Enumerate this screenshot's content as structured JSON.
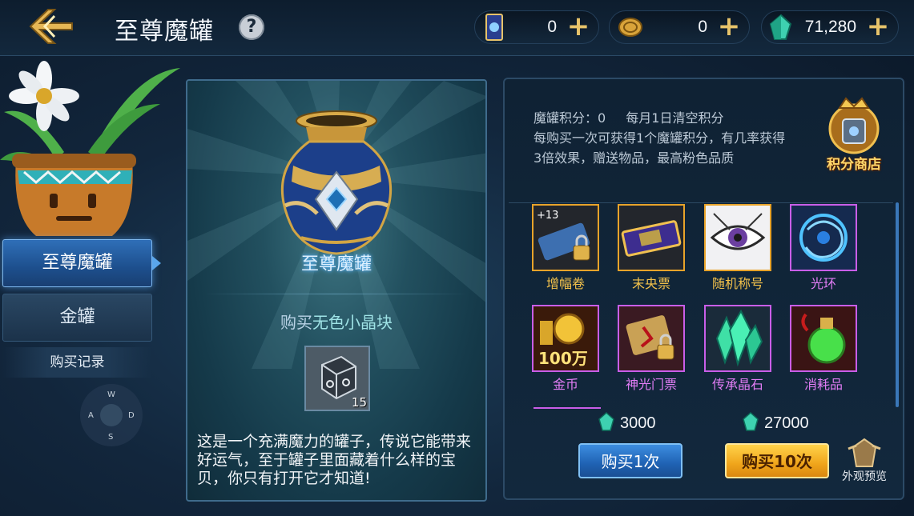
{
  "header": {
    "title": "至尊魔罐",
    "help": "?",
    "resources": [
      {
        "icon": "card-ticket-icon",
        "value": "0"
      },
      {
        "icon": "gold-coin-icon",
        "value": "0"
      },
      {
        "icon": "green-crystal-icon",
        "value": "71,280"
      }
    ],
    "plus": "+"
  },
  "sidebar": {
    "tabs": [
      {
        "label": "至尊魔罐",
        "active": true
      },
      {
        "label": "金罐",
        "active": false
      }
    ],
    "record": "购买记录",
    "compass": {
      "n": "W",
      "w": "A",
      "e": "D",
      "s": "S"
    }
  },
  "jar_panel": {
    "name": "至尊魔罐",
    "buy_prefix": "购买",
    "buy_item": "无色小晶块",
    "crystal_count": "15",
    "description": "这是一个充满魔力的罐子，传说它能带来好运气，至于罐子里面藏着什么样的宝贝，你只有打开它才知道!"
  },
  "reward_panel": {
    "points_label": "魔罐积分：0",
    "reset_note": "每月1日清空积分",
    "rule": "每购买一次可获得1个魔罐积分，有几率获得3倍效果，赠送物品，最高粉色品质",
    "shop_label": "积分商店",
    "items": [
      {
        "name": "增幅卷",
        "rarity": "gold",
        "icon": "amplify-scroll-icon",
        "badge": "+13"
      },
      {
        "name": "末央票",
        "rarity": "gold",
        "icon": "ticket-icon"
      },
      {
        "name": "随机称号",
        "rarity": "gold",
        "icon": "title-eye-icon"
      },
      {
        "name": "光环",
        "rarity": "purple",
        "icon": "aura-icon"
      },
      {
        "name": "金币",
        "rarity": "purple",
        "icon": "gold-coins-icon",
        "badge": "100万"
      },
      {
        "name": "神光门票",
        "rarity": "purple",
        "icon": "locked-ticket-icon"
      },
      {
        "name": "传承晶石",
        "rarity": "purple",
        "icon": "crystal-icon"
      },
      {
        "name": "消耗品",
        "rarity": "purple",
        "icon": "potion-icon"
      }
    ],
    "price_single": "3000",
    "price_ten": "27000",
    "buy_one": "购买1次",
    "buy_ten": "购买10次",
    "preview": "外观预览"
  },
  "colors": {
    "gold_rarity": "#e8a32a",
    "purple_rarity": "#c95ee8",
    "accent_blue": "#2f6fb8"
  }
}
